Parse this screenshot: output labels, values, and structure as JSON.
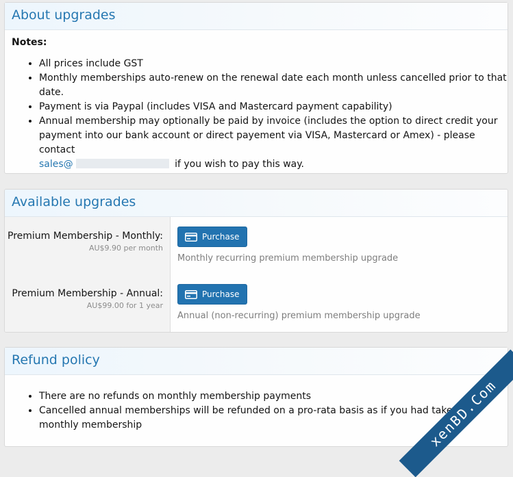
{
  "about": {
    "title": "About upgrades",
    "notes_label": "Notes:",
    "items": [
      "All prices include GST",
      "Monthly memberships auto-renew on the renewal date each month unless cancelled prior to that date.",
      "Payment is via Paypal (includes VISA and Mastercard payment capability)"
    ],
    "annual_item_text": "Annual membership may optionally be paid by invoice (includes the option to direct credit your payment into our bank account or direct payement via VISA, Mastercard or Amex) - please contact",
    "email_prefix": "sales@",
    "annual_item_suffix": "if you wish to pay this way."
  },
  "upgrades": {
    "title": "Available upgrades",
    "rows": [
      {
        "title": "Premium Membership - Monthly:",
        "price": "AU$9.90 per month",
        "button_label": "Purchase",
        "description": "Monthly recurring premium membership upgrade"
      },
      {
        "title": "Premium Membership - Annual:",
        "price": "AU$99.00 for 1 year",
        "button_label": "Purchase",
        "description": "Annual (non-recurring) premium membership upgrade"
      }
    ]
  },
  "refund": {
    "title": "Refund policy",
    "items": [
      "There are no refunds on monthly membership payments",
      "Cancelled annual memberships will be refunded on a pro-rata basis as if you had taken out monthly membership"
    ]
  },
  "watermark": {
    "text": "xenBD.Com"
  },
  "colors": {
    "accent": "#2577b1",
    "button": "#2273b0",
    "watermark": "#1c5a8c"
  }
}
